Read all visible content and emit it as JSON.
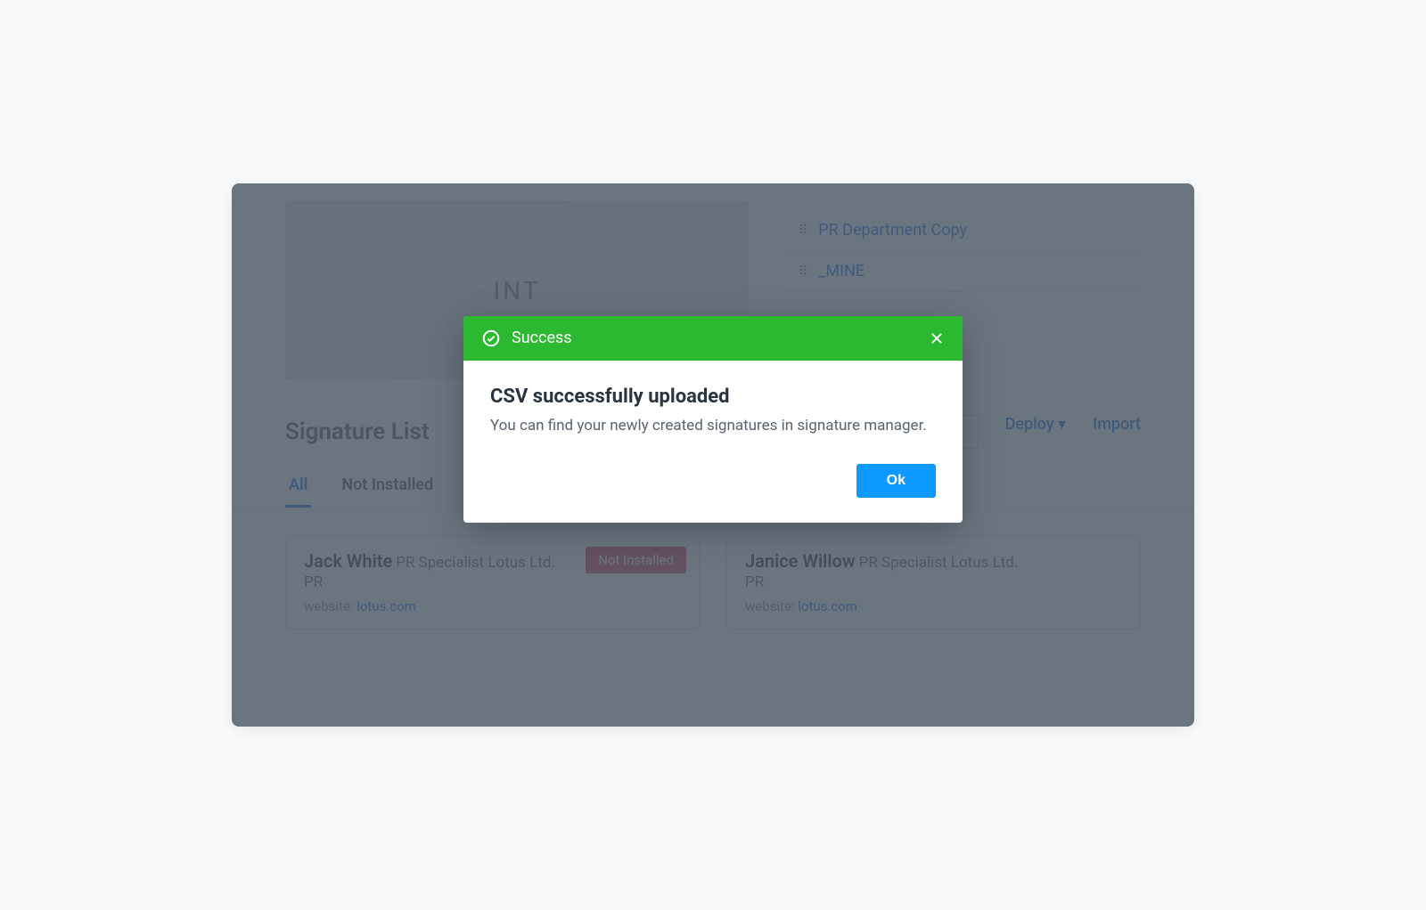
{
  "modal": {
    "header_label": "Success",
    "title": "CSV successfully uploaded",
    "body": "You can find your newly created signatures in signature manager.",
    "ok_label": "Ok"
  },
  "logo_text": "INT",
  "right_panel": {
    "items": [
      {
        "label": "PR Department Copy"
      },
      {
        "label": "_MINE"
      }
    ]
  },
  "section": {
    "title": "Signature List",
    "deploy_label": "Deploy",
    "import_label": "Import"
  },
  "tabs": {
    "all": "All",
    "not_installed": "Not Installed"
  },
  "cards": [
    {
      "name": "Jack White",
      "title": "PR Specialist Lotus Ltd.",
      "dept": "PR",
      "website_label": "website:",
      "website_value": "lotus.com",
      "badge": "Not Installed"
    },
    {
      "name": "Janice Willow",
      "title": "PR Specialist Lotus Ltd.",
      "dept": "PR",
      "website_label": "website:",
      "website_value": "lotus.com"
    }
  ]
}
